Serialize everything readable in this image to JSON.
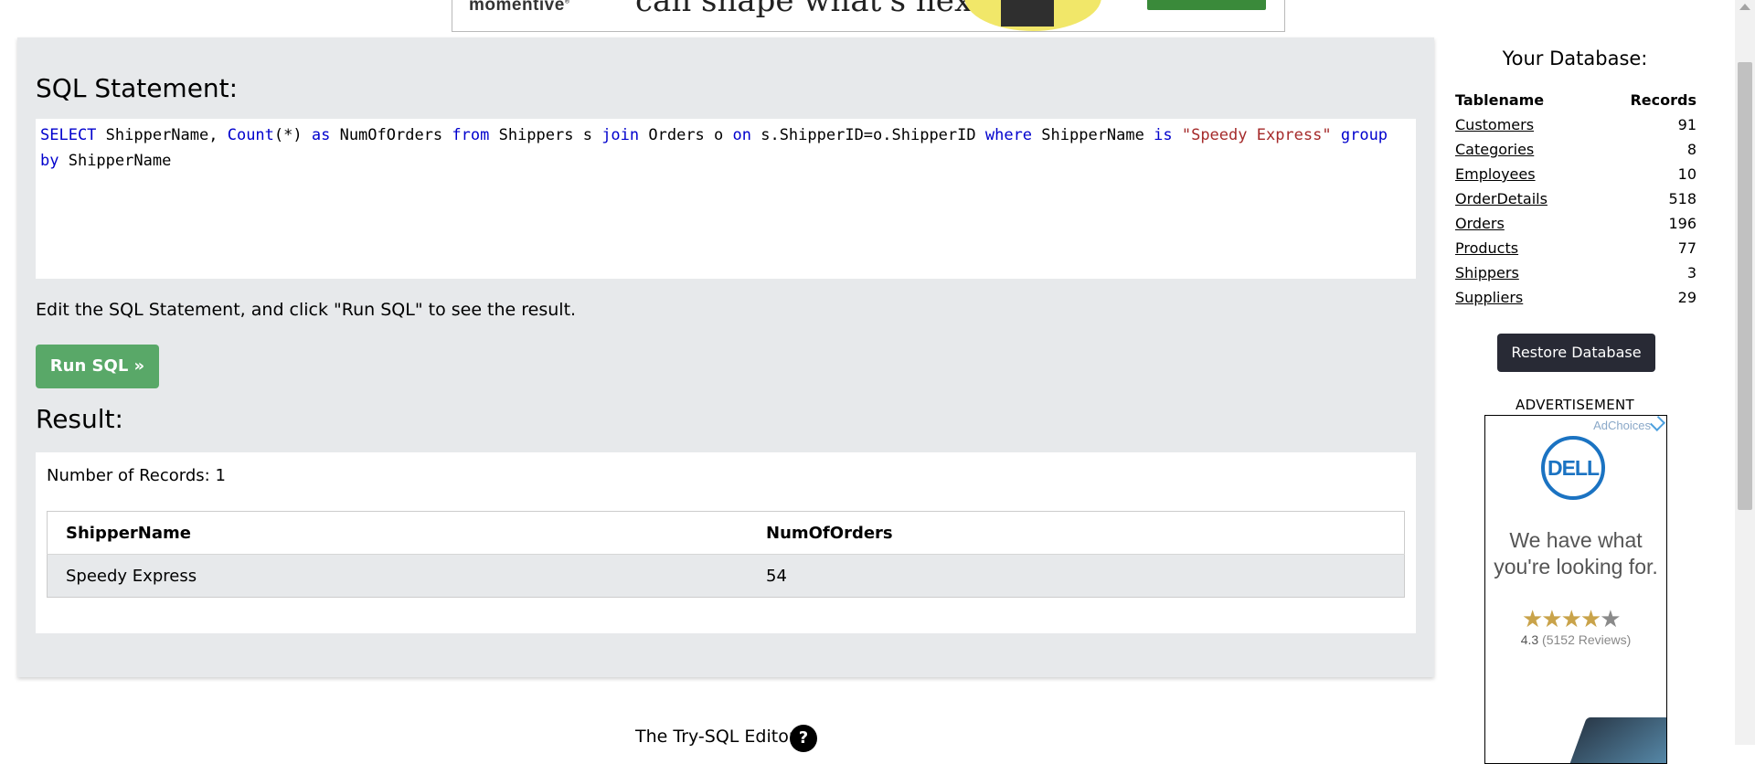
{
  "top_ad": {
    "brand": "momentive",
    "headline": "can shape what's next"
  },
  "sql_section": {
    "title": "SQL Statement:",
    "statement_tokens": [
      {
        "t": "SELECT",
        "c": "kw"
      },
      {
        "t": " ShipperName, ",
        "c": ""
      },
      {
        "t": "Count",
        "c": "kw"
      },
      {
        "t": "(*) ",
        "c": ""
      },
      {
        "t": "as",
        "c": "kw"
      },
      {
        "t": " NumOfOrders ",
        "c": ""
      },
      {
        "t": "from",
        "c": "kw"
      },
      {
        "t": " Shippers s ",
        "c": ""
      },
      {
        "t": "join",
        "c": "kw"
      },
      {
        "t": " Orders o ",
        "c": ""
      },
      {
        "t": "on",
        "c": "kw"
      },
      {
        "t": " s.ShipperID=o.ShipperID ",
        "c": ""
      },
      {
        "t": "where",
        "c": "kw"
      },
      {
        "t": " ShipperName ",
        "c": ""
      },
      {
        "t": "is",
        "c": "kw"
      },
      {
        "t": " ",
        "c": ""
      },
      {
        "t": "\"Speedy Express\"",
        "c": "str"
      },
      {
        "t": " ",
        "c": ""
      },
      {
        "t": "group by",
        "c": "kw"
      },
      {
        "t": " ShipperName",
        "c": ""
      }
    ],
    "edit_note": "Edit the SQL Statement, and click \"Run SQL\" to see the result.",
    "run_button": "Run SQL »"
  },
  "result_section": {
    "title": "Result:",
    "record_count": "Number of Records: 1",
    "columns": [
      "ShipperName",
      "NumOfOrders"
    ],
    "rows": [
      [
        "Speedy Express",
        "54"
      ]
    ]
  },
  "footer": {
    "editor_label": "The Try-SQL Editor",
    "help": "?"
  },
  "database": {
    "title": "Your Database:",
    "col_table": "Tablename",
    "col_records": "Records",
    "tables": [
      {
        "name": "Customers",
        "records": "91"
      },
      {
        "name": "Categories",
        "records": "8"
      },
      {
        "name": "Employees",
        "records": "10"
      },
      {
        "name": "OrderDetails",
        "records": "518"
      },
      {
        "name": "Orders",
        "records": "196"
      },
      {
        "name": "Products",
        "records": "77"
      },
      {
        "name": "Shippers",
        "records": "3"
      },
      {
        "name": "Suppliers",
        "records": "29"
      }
    ],
    "restore_button": "Restore Database"
  },
  "side_ad": {
    "label": "ADVERTISEMENT",
    "adchoices": "AdChoices",
    "logo": "DELL",
    "headline": "We have what you're looking for.",
    "stars": "★★★★",
    "star_dim": "★",
    "rating_value": "4.3",
    "rating_count": "(5152 Reviews)"
  },
  "colors": {
    "panel_bg": "#e7e9eb",
    "run_button": "#59a868",
    "restore_button": "#282a35",
    "sql_keyword": "#0000cd",
    "sql_string": "#a52a2a"
  }
}
